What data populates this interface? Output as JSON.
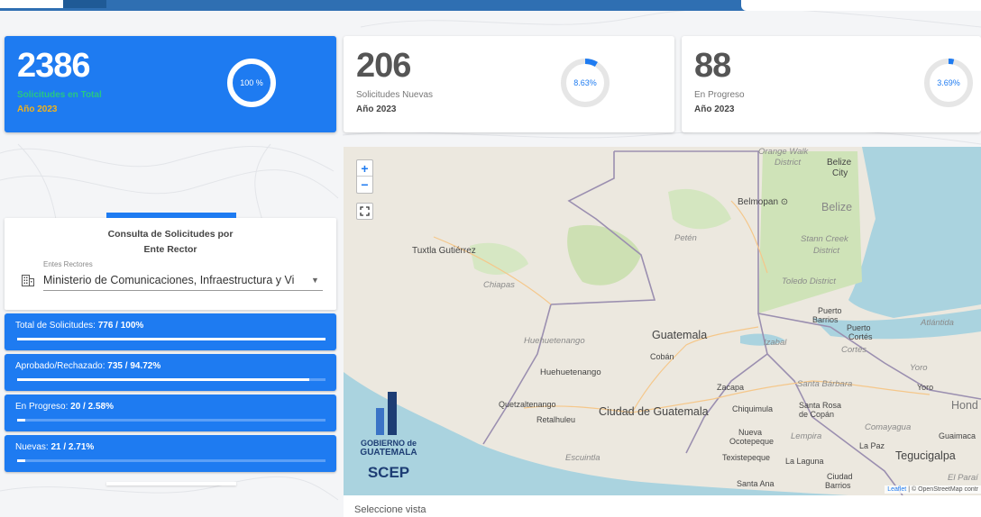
{
  "cards": [
    {
      "number": "2386",
      "label": "Solicitudes en Total",
      "year": "Año 2023",
      "percent_text": "100 %",
      "percent": 100
    },
    {
      "number": "206",
      "label": "Solicitudes Nuevas",
      "year": "Año 2023",
      "percent_text": "8.63%",
      "percent": 8.63
    },
    {
      "number": "88",
      "label": "En Progreso",
      "year": "Año 2023",
      "percent_text": "3.69%",
      "percent": 3.69
    }
  ],
  "consulta": {
    "title_line1": "Consulta de Solicitudes por",
    "title_line2": "Ente Rector",
    "field_label": "Entes Rectores",
    "field_value": "Ministerio de Comunicaciones, Infraestructura y Vi"
  },
  "stats": [
    {
      "label": "Total de Solicitudes: ",
      "value": "776 / 100%",
      "progress": 100
    },
    {
      "label": "Aprobado/Rechazado: ",
      "value": "735 / 94.72%",
      "progress": 94.72
    },
    {
      "label": "En Progreso: ",
      "value": "20 / 2.58%",
      "progress": 2.58
    },
    {
      "label": "Nuevas: ",
      "value": "21 / 2.71%",
      "progress": 2.71
    }
  ],
  "map": {
    "zoom_in": "+",
    "zoom_out": "−",
    "places": {
      "orange_walk": "Orange Walk",
      "district": "District",
      "belize_city": "Belize",
      "city": "City",
      "belmopan": "Belmopan ⊙",
      "belize": "Belize",
      "peten": "Petén",
      "stann_creek": "Stann Creek",
      "district2": "District",
      "toledo": "Toledo District",
      "tuxtla": "Tuxtla Gutiérrez",
      "chiapas": "Chiapas",
      "puerto_barrios": "Puerto",
      "puerto_barrios2": "Barrios",
      "puerto_cortes": "Puerto",
      "puerto_cortes2": "Cortés",
      "cortes": "Cortés",
      "atlantida": "Atlántida",
      "huehuetenango_dept": "Huehuetenango",
      "guatemala": "Guatemala",
      "izabal": "Izabal",
      "coban": "Cobán",
      "yoro_dept": "Yoro",
      "yoro": "Yoro",
      "huehuetenango": "Huehuetenango",
      "zacapa": "Zacapa",
      "santa_barbara": "Santa Bárbara",
      "hond": "Hond",
      "quetzaltenango": "Quetzaltenango",
      "retalhuleu": "Retalhuleu",
      "ciudad_guatemala": "Ciudad de Guatemala",
      "chiquimula": "Chiquimula",
      "santa_rosa": "Santa Rosa",
      "de_copan": "de Copán",
      "comayagua": "Comayagua",
      "guaimaca": "Guaimaca",
      "nueva": "Nueva",
      "ocotepeque": "Ocotepeque",
      "lempira": "Lempira",
      "la_paz": "La Paz",
      "tegucigalpa": "Tegucigalpa",
      "escuintla": "Escuintla",
      "texistepeque": "Texistepeque",
      "la_laguna": "La Laguna",
      "el_paraiso": "El Paraí",
      "ciudad_barrios": "Ciudad",
      "ciudad_barrios2": "Barrios",
      "santa_ana": "Santa Ana"
    },
    "logo_line1": "GOBIERNO de",
    "logo_line2": "GUATEMALA",
    "logo_line3": "SCEP",
    "attribution_link": "Leaflet",
    "attribution_rest": " | © OpenStreetMap contr"
  },
  "footer": {
    "seleccione": "Seleccione vista"
  }
}
